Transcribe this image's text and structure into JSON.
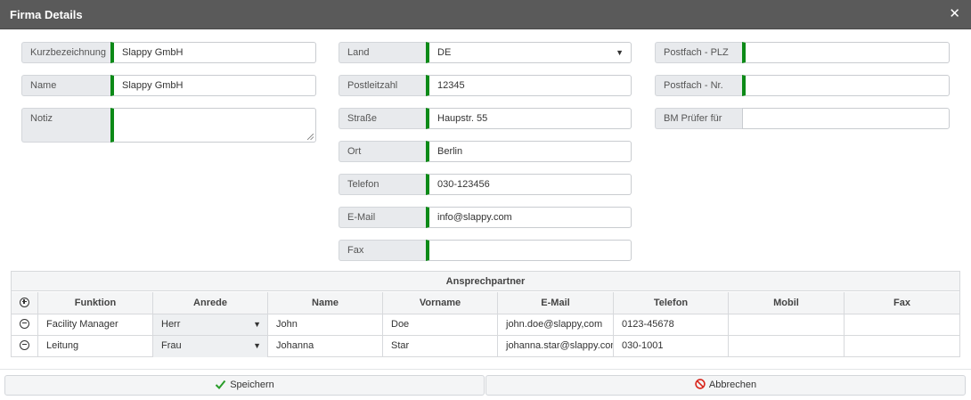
{
  "dialog": {
    "title": "Firma Details",
    "close_glyph": "✕"
  },
  "fields": {
    "kurzbezeichnung": {
      "label": "Kurzbezeichnung",
      "value": "Slappy GmbH"
    },
    "name": {
      "label": "Name",
      "value": "Slappy GmbH"
    },
    "notiz": {
      "label": "Notiz",
      "value": ""
    },
    "land": {
      "label": "Land",
      "value": "DE"
    },
    "postleitzahl": {
      "label": "Postleitzahl",
      "value": "12345"
    },
    "strasse": {
      "label": "Straße",
      "value": "Haupstr. 55"
    },
    "ort": {
      "label": "Ort",
      "value": "Berlin"
    },
    "telefon": {
      "label": "Telefon",
      "value": "030-123456"
    },
    "email": {
      "label": "E-Mail",
      "value": "info@slappy.com"
    },
    "fax": {
      "label": "Fax",
      "value": ""
    },
    "postfach_plz": {
      "label": "Postfach - PLZ",
      "value": ""
    },
    "postfach_nr": {
      "label": "Postfach - Nr.",
      "value": ""
    },
    "bm_pruefer": {
      "label": "BM Prüfer für",
      "value": ""
    }
  },
  "contacts": {
    "caption": "Ansprechpartner",
    "columns": [
      "Funktion",
      "Anrede",
      "Name",
      "Vorname",
      "E-Mail",
      "Telefon",
      "Mobil",
      "Fax"
    ],
    "rows": [
      {
        "funktion": "Facility Manager",
        "anrede": "Herr",
        "name": "John",
        "vorname": "Doe",
        "email": "john.doe@slappy,com",
        "telefon": "0123-45678",
        "mobil": "",
        "fax": ""
      },
      {
        "funktion": "Leitung",
        "anrede": "Frau",
        "name": "Johanna",
        "vorname": "Star",
        "email": "johanna.star@slappy.com",
        "telefon": "030-1001",
        "mobil": "",
        "fax": ""
      }
    ]
  },
  "buttons": {
    "save": "Speichern",
    "cancel": "Abbrechen"
  },
  "icons": {
    "close": "close-icon",
    "dropdown": "chevron-down-icon",
    "add": "plus-circle-icon",
    "remove": "minus-circle-icon",
    "save": "checkmark-icon",
    "cancel": "prohibited-icon"
  },
  "colors": {
    "titlebar": "#5a5a5a",
    "required_marker": "#0c8a17",
    "save_icon": "#2a9d2a",
    "cancel_icon": "#d9261c"
  }
}
